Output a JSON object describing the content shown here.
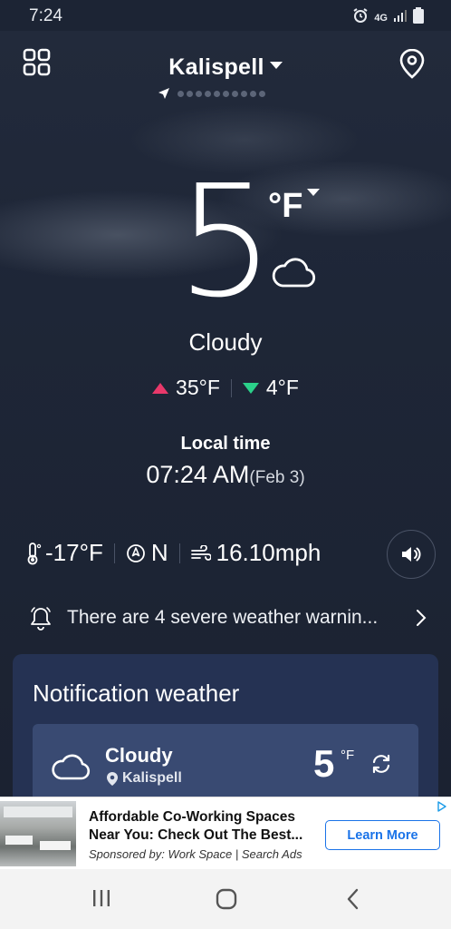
{
  "status_bar": {
    "time": "7:24",
    "network": "4G"
  },
  "header": {
    "location": "Kalispell",
    "page_dot_count": 10
  },
  "current": {
    "temperature": "5",
    "unit": "°F",
    "condition": "Cloudy",
    "high": "35°F",
    "low": "4°F",
    "local_time_label": "Local time",
    "local_time": "07:24 AM",
    "local_date": "(Feb 3)",
    "feels_like": "-17°F",
    "wind_direction": "N",
    "wind_speed": "16.10mph"
  },
  "warning": {
    "text": "There are 4 severe weather warnin..."
  },
  "notification": {
    "title": "Notification weather",
    "condition": "Cloudy",
    "location": "Kalispell",
    "temperature": "5",
    "unit": "°F"
  },
  "ad": {
    "title": "Affordable Co-Working Spaces Near You: Check Out The Best...",
    "sponsor": "Sponsored by: Work Space | Search Ads",
    "cta": "Learn More"
  },
  "colors": {
    "high_arrow": "#e8386a",
    "low_arrow": "#2bd18a",
    "ad_cta": "#1a73e8",
    "background": "#1b2333"
  },
  "icons": [
    "grid-icon",
    "location-pin-icon",
    "cloud-icon",
    "thermometer-icon",
    "compass-icon",
    "wind-icon",
    "speaker-icon",
    "bell-icon",
    "chevron-right-icon",
    "refresh-icon"
  ]
}
